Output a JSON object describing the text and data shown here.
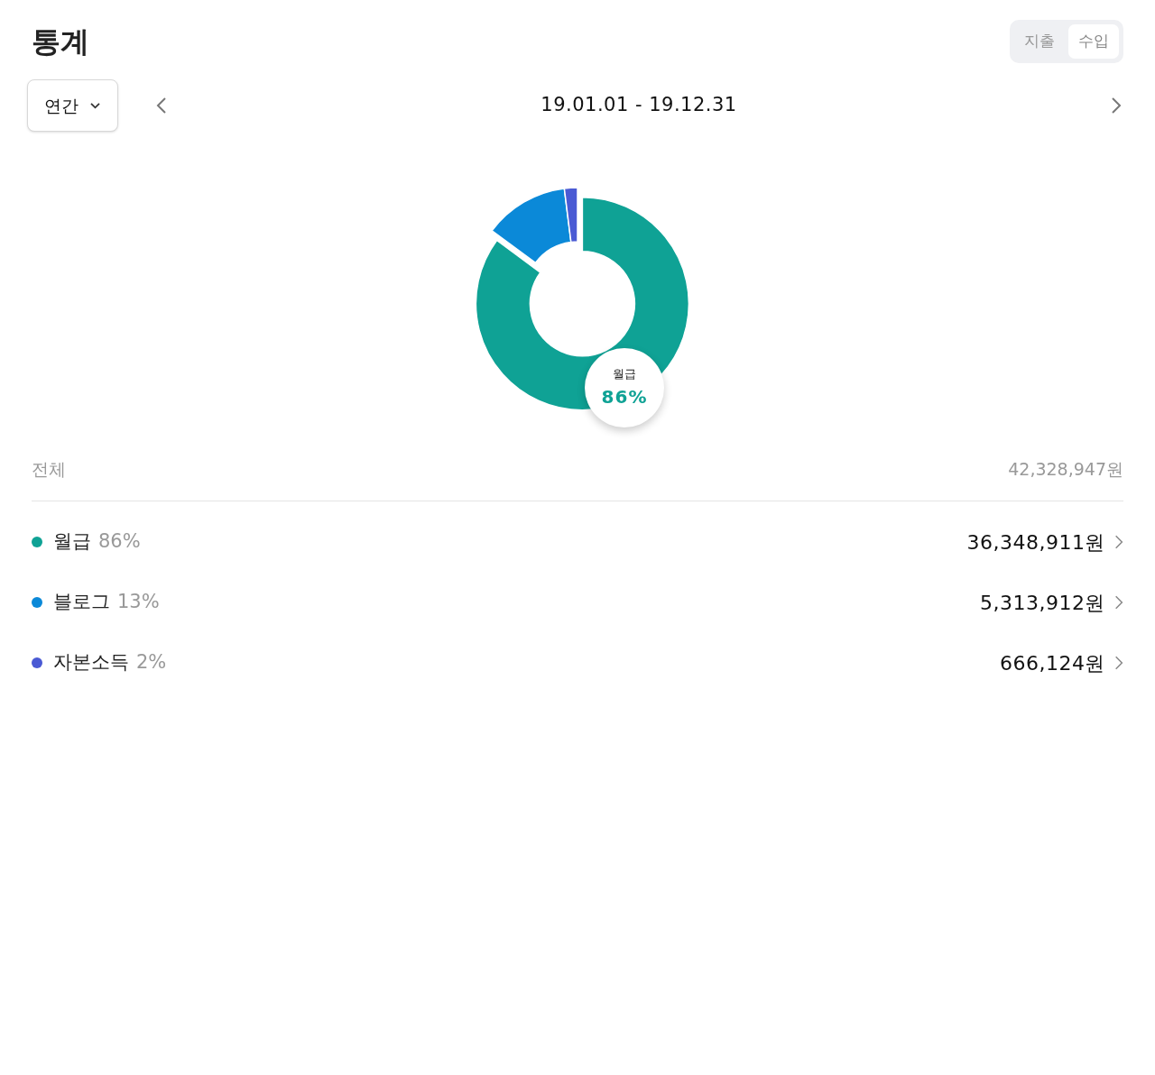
{
  "title": "통계",
  "type_toggle": [
    {
      "label": "지출",
      "selected": false
    },
    {
      "label": "수입",
      "selected": true
    }
  ],
  "period_dropdown": {
    "value": "연간"
  },
  "date_range": "19.01.01 - 19.12.31",
  "chart": {
    "callout": {
      "label": "월급",
      "value": "86%"
    },
    "chart_data": {
      "type": "donut",
      "categories": [
        "월급",
        "블로그",
        "자본소득"
      ],
      "values": [
        86,
        13,
        2
      ]
    }
  },
  "total": {
    "label": "전체",
    "amount": "42,328,947원"
  },
  "items": [
    {
      "percent": "86%",
      "amount": "36,348,911원",
      "color": "#0fa295",
      "selected": true
    },
    {
      "percent": "13%",
      "amount": "5,313,912원",
      "color": "#0b89d8",
      "selected": false
    },
    {
      "percent": "2%",
      "amount": "666,124원",
      "color": "#4a5ad4",
      "selected": false
    }
  ]
}
